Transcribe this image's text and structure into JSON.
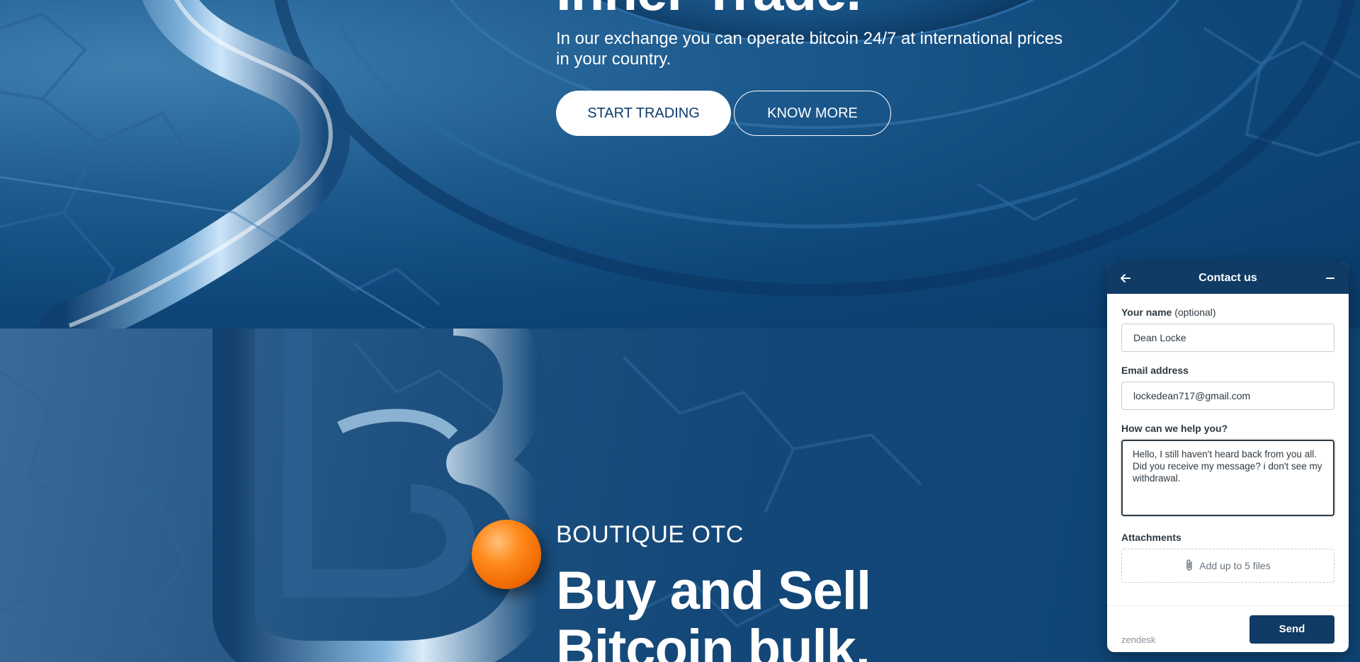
{
  "hero": {
    "title": "Inner Trade.",
    "subtitle": "In our exchange you can operate bitcoin 24/7 at international prices in your country.",
    "start_label": "START TRADING",
    "know_label": "KNOW MORE"
  },
  "otc": {
    "eyebrow": "BOUTIQUE OTC",
    "title_line1": "Buy and Sell",
    "title_line2": "Bitcoin bulk."
  },
  "widget": {
    "title": "Contact us",
    "back_icon": "arrow-left-icon",
    "minimize_icon": "minimize-icon",
    "name_label": "Your name",
    "name_optional": "(optional)",
    "name_value": "Dean Locke",
    "email_label": "Email address",
    "email_value": "lockedean717@gmail.com",
    "help_label": "How can we help you?",
    "help_value": "Hello, I still haven't heard back from you all. Did you receive my message? i don't see my withdrawal.",
    "attachments_label": "Attachments",
    "attach_text": "Add up to 5 files",
    "attach_icon": "paperclip-icon",
    "brand": "zendesk",
    "send_label": "Send",
    "accent": "#0f3b64"
  }
}
